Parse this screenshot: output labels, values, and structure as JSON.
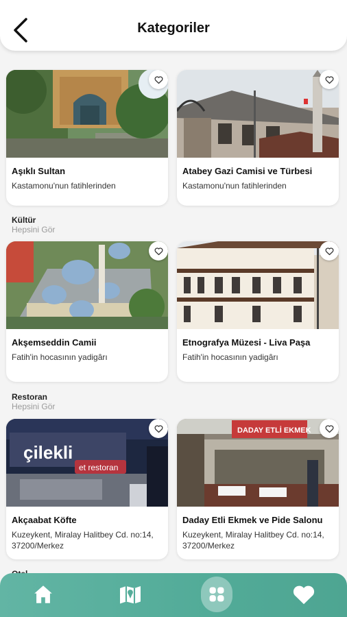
{
  "header": {
    "title": "Kategoriler"
  },
  "sections": [
    {
      "cards": [
        {
          "name": "Aşıklı Sultan",
          "subtitle": "Kastamonu'nun fatihlerinden"
        },
        {
          "name": "Atabey Gazi Camisi ve Türbesi",
          "subtitle": "Kastamonu'nun fatihlerinden"
        }
      ]
    },
    {
      "title": "Kültür",
      "see_all": "Hepsini Gör",
      "cards": [
        {
          "name": "Akşemseddin Camii",
          "subtitle": "Fatih'in hocasının yadigârı"
        },
        {
          "name": "Etnografya Müzesi - Liva Paşa",
          "subtitle": "Fatih'in hocasının yadigârı"
        }
      ]
    },
    {
      "title": "Restoran",
      "see_all": "Hepsini Gör",
      "cards": [
        {
          "name": "Akçaabat Köfte",
          "subtitle": "Kuzeykent, Miralay Halitbey Cd. no:14, 37200/Merkez",
          "sign": "çilekli",
          "sign2": "et restoran"
        },
        {
          "name": "Daday Etli Ekmek ve Pide Salonu",
          "subtitle": "Kuzeykent, Miralay Halitbey Cd. no:14, 37200/Merkez",
          "sign": "DADAY ETLİ EKMEK"
        }
      ]
    },
    {
      "title": "Otel"
    }
  ],
  "colors": {
    "nav_bg": "#55ad9a",
    "accent": "#52ab98"
  },
  "icons": {
    "back": "chevron-left-icon",
    "favorite": "heart-outline-icon",
    "nav": [
      "home-icon",
      "map-icon",
      "grid-icon",
      "heart-icon"
    ]
  }
}
